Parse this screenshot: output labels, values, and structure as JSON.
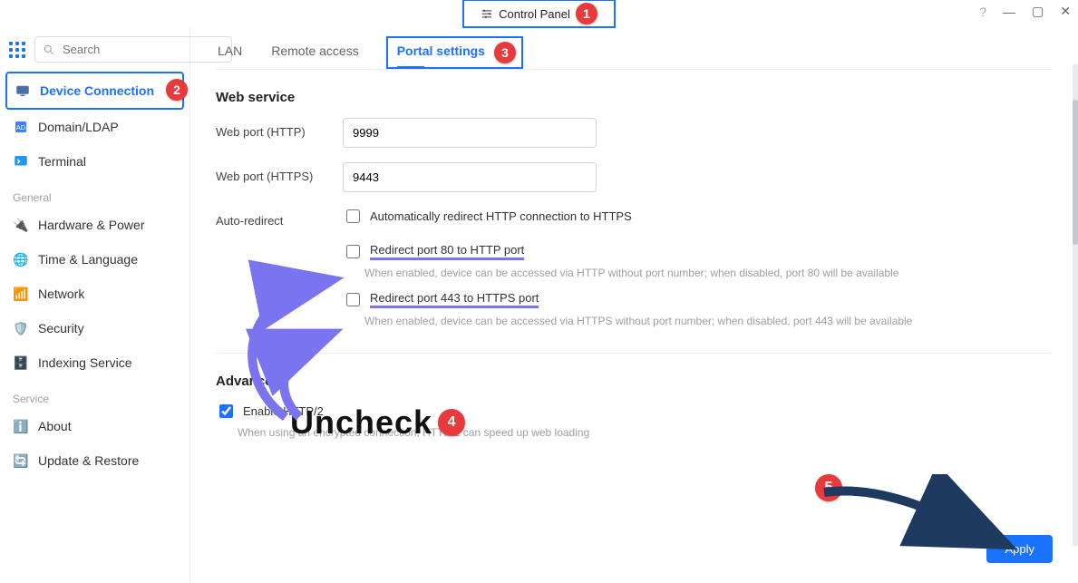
{
  "titlebar": {
    "title": "Control Panel"
  },
  "search": {
    "placeholder": "Search"
  },
  "sidebar": {
    "items": [
      {
        "label": "Device Connection"
      },
      {
        "label": "Domain/LDAP"
      },
      {
        "label": "Terminal"
      }
    ],
    "section_general": "General",
    "general_items": [
      {
        "label": "Hardware & Power"
      },
      {
        "label": "Time & Language"
      },
      {
        "label": "Network"
      },
      {
        "label": "Security"
      },
      {
        "label": "Indexing Service"
      }
    ],
    "section_service": "Service",
    "service_items": [
      {
        "label": "About"
      },
      {
        "label": "Update & Restore"
      }
    ]
  },
  "tabs": {
    "lan": "LAN",
    "remote": "Remote access",
    "portal": "Portal settings"
  },
  "web_service": {
    "heading": "Web service",
    "http_label": "Web port (HTTP)",
    "http_value": "9999",
    "https_label": "Web port (HTTPS)",
    "https_value": "9443",
    "redirect_label": "Auto-redirect",
    "redirect_auto": "Automatically redirect HTTP connection to HTTPS",
    "redirect80": "Redirect port 80 to HTTP port",
    "redirect80_desc": "When enabled, device can be accessed via HTTP without port number; when disabled, port 80 will be available",
    "redirect443": "Redirect port 443 to HTTPS port",
    "redirect443_desc": "When enabled, device can be accessed via HTTPS without port number; when disabled, port 443 will be available"
  },
  "advanced": {
    "heading": "Advanced",
    "http2": "Enable HTTP/2",
    "http2_desc": "When using an encrypted connection, HTTP/2 can speed up web loading"
  },
  "buttons": {
    "apply": "Apply"
  },
  "annotations": {
    "n1": "1",
    "n2": "2",
    "n3": "3",
    "n4": "4",
    "n5": "5",
    "uncheck": "Uncheck"
  }
}
